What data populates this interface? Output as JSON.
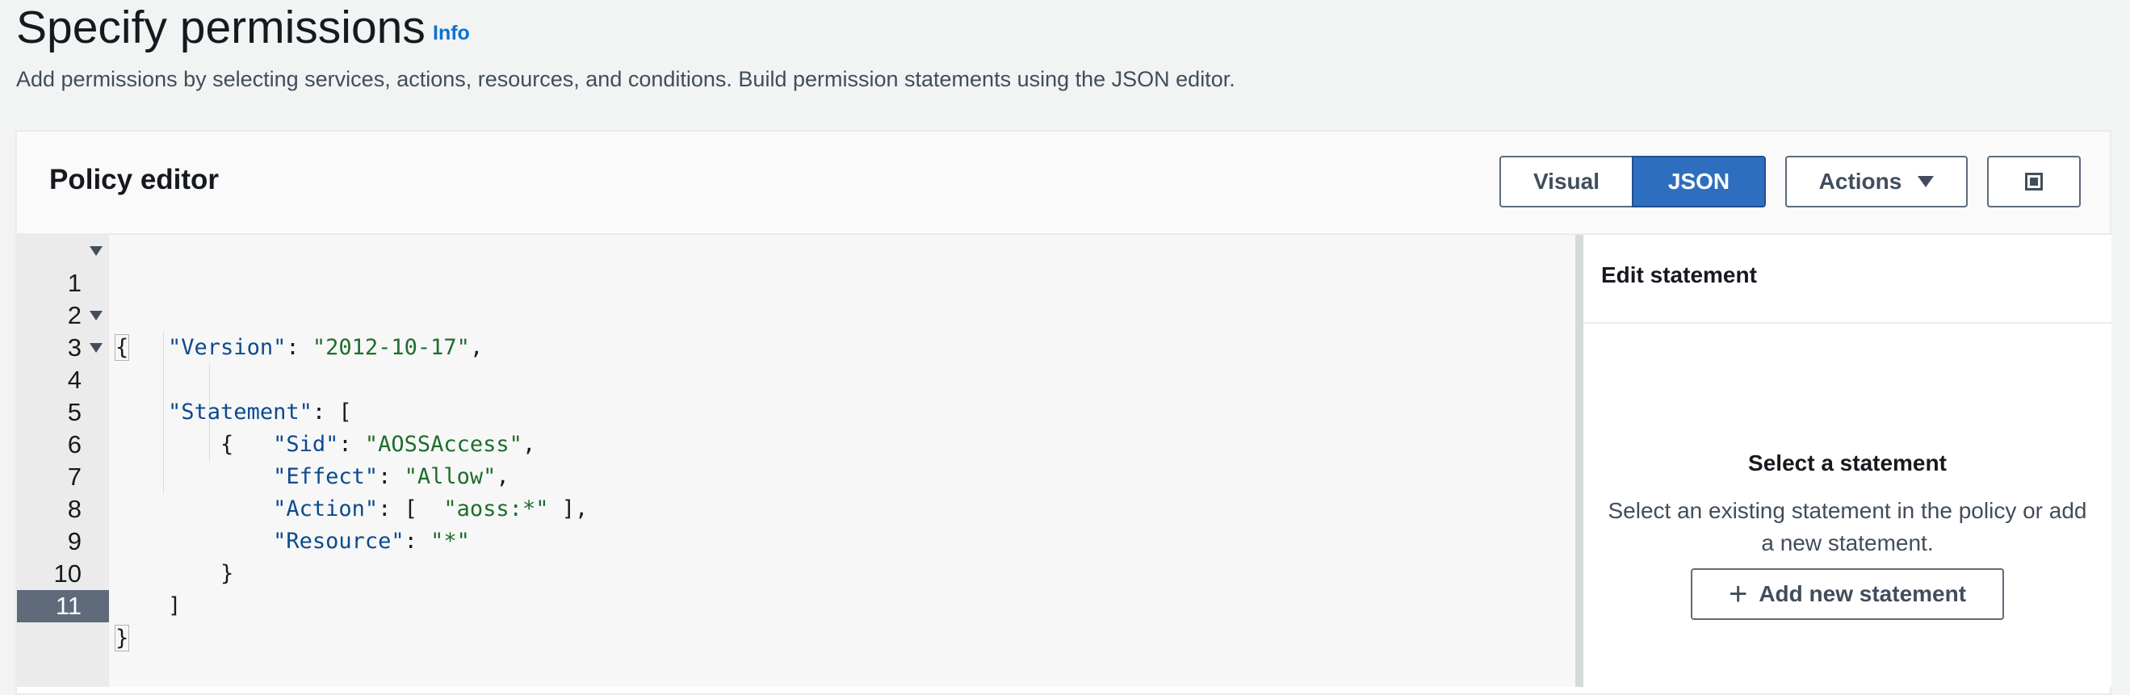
{
  "page": {
    "title": "Specify permissions",
    "info_label": "Info",
    "description": "Add permissions by selecting services, actions, resources, and conditions. Build permission statements using the JSON editor."
  },
  "editor_header": {
    "title": "Policy editor",
    "mode_visual": "Visual",
    "mode_json": "JSON",
    "selected_mode": "JSON",
    "actions_label": "Actions",
    "fullscreen_icon": "fullscreen-icon"
  },
  "code": {
    "line_numbers": [
      "1",
      "2",
      "3",
      "4",
      "5",
      "6",
      "7",
      "8",
      "9",
      "10",
      "11"
    ],
    "active_line": "11",
    "l1": "{",
    "l2_key": "\"Version\"",
    "l2_sep": ": ",
    "l2_val": "\"2012-10-17\"",
    "l2_end": ",",
    "l3_key": "\"Statement\"",
    "l3_end": ": [",
    "l4": "{",
    "l5_key": "\"Sid\"",
    "l5_sep": ": ",
    "l5_val": "\"AOSSAccess\"",
    "l5_end": ",",
    "l6_key": "\"Effect\"",
    "l6_sep": ": ",
    "l6_val": "\"Allow\"",
    "l6_end": ",",
    "l7_key": "\"Action\"",
    "l7_sep": ": [  ",
    "l7_val": "\"aoss:*\"",
    "l7_end": " ],",
    "l8_key": "\"Resource\"",
    "l8_sep": ": ",
    "l8_val": "\"*\"",
    "l9": "}",
    "l10": "]",
    "l11": "}"
  },
  "side_panel": {
    "title": "Edit statement",
    "empty_title": "Select a statement",
    "empty_desc": "Select an existing statement in the policy or add a new statement.",
    "add_button": "Add new statement"
  },
  "colors": {
    "accent": "#2e6ebe",
    "json_key": "#0b4a8f",
    "json_string": "#1e6d2c"
  }
}
